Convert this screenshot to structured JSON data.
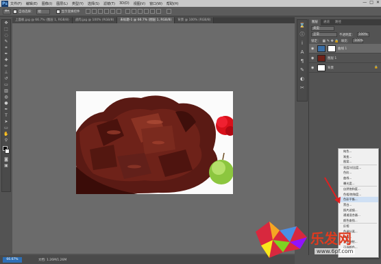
{
  "app": {
    "logo": "Ps"
  },
  "menubar": {
    "items": [
      "文件(F)",
      "编辑(E)",
      "图像(I)",
      "图层(L)",
      "类型(Y)",
      "选择(S)",
      "滤镜(T)",
      "3D(D)",
      "视图(V)",
      "窗口(W)",
      "帮助(H)"
    ]
  },
  "window_controls": [
    "—",
    "□",
    "✕"
  ],
  "options": {
    "auto_select_label": "自动选择：",
    "auto_select_value": "组",
    "transform_label": "显示变换控件"
  },
  "tabs": [
    {
      "label": "上面板.jpg @ 66.7% (图层 1, RGB/8)"
    },
    {
      "label": "卤肉.jpg @ 100% (RGB/8)"
    },
    {
      "label": "未标题-1 @ 66.7% (图层 1, RGB/8)"
    },
    {
      "label": "背景 @ 100% (RGB/8)"
    }
  ],
  "status": {
    "zoom": "66.67%",
    "doc": "文档: 1.26M/1.26M"
  },
  "layers_panel": {
    "tabs": [
      "图层",
      "通道",
      "路径"
    ],
    "kind_label": "类型",
    "blend_mode": "正常",
    "opacity_label": "不透明度：",
    "opacity_value": "100%",
    "lock_label": "锁定：",
    "fill_label": "填充：",
    "fill_value": "100%",
    "layers": [
      {
        "name": "曲线 1"
      },
      {
        "name": "图层 1"
      },
      {
        "name": "背景"
      }
    ]
  },
  "context_menu": {
    "items": [
      "纯色...",
      "渐变...",
      "图案...",
      "亮度/对比度...",
      "色阶...",
      "曲线...",
      "曝光度...",
      "自然饱和度...",
      "色相/饱和度...",
      "色彩平衡...",
      "黑白...",
      "照片滤镜...",
      "通道混合器...",
      "颜色查找...",
      "反相",
      "色调分离...",
      "阈值...",
      "渐变映射...",
      "可选颜色..."
    ],
    "highlighted": "色彩平衡..."
  },
  "watermark": {
    "text": "乐发网",
    "url": "www.6pf.com"
  }
}
